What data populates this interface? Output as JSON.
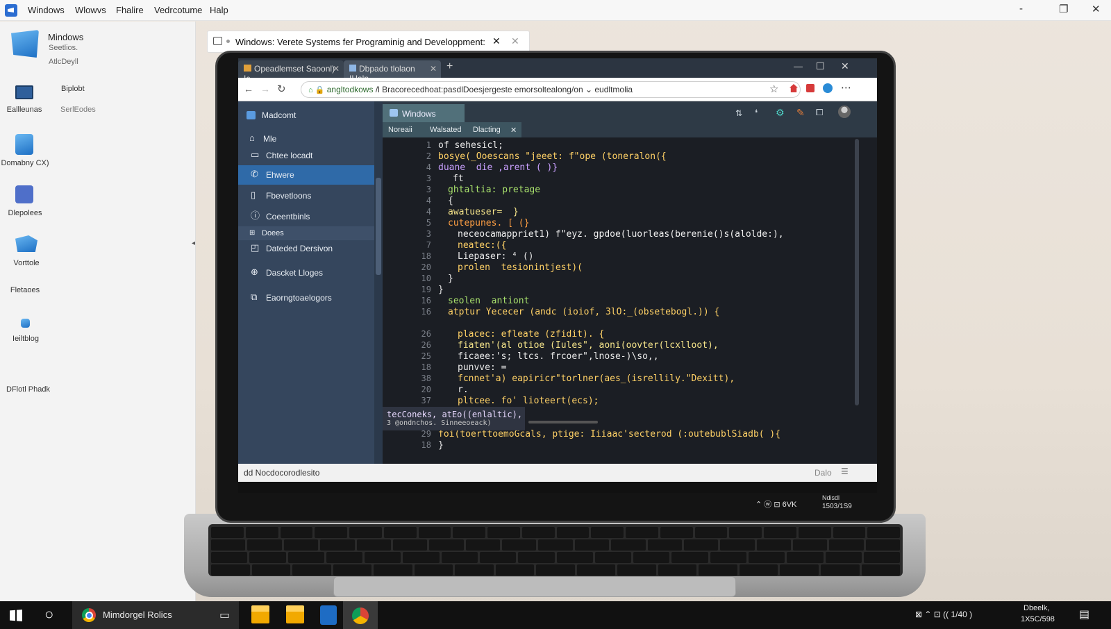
{
  "outer_window": {
    "menu": [
      "Windows",
      "Wlowvs",
      "Fhalire",
      "Vedrcotume",
      "Halp"
    ],
    "controls": {
      "minimize": "-",
      "restore": "❐",
      "close": "✕"
    }
  },
  "left_sidebar": {
    "title": "Mindows",
    "subtitle1": "Seetlios.",
    "subtitle2": "AtlcDeyll",
    "items": [
      {
        "label": "Eallleunas",
        "side": "Biplobt"
      },
      {
        "label": "Domabny CX)",
        "side": "SerlEodes"
      },
      {
        "label": "Dlepolees"
      },
      {
        "label": "Vorttole"
      },
      {
        "label": "Fletaoes"
      },
      {
        "label": "Ieiltblog"
      },
      {
        "label": "DFlotl Phadk"
      }
    ]
  },
  "outer_tab": {
    "title": "Windows: Verete Systems fer Programinig and Developpment:",
    "close": "✕"
  },
  "browser": {
    "tabs": [
      {
        "label": "Opeadlemset Saoonl) Ic"
      },
      {
        "label": "Dbpado tlolaon IHalp"
      }
    ],
    "new_tab": "+",
    "win_controls": {
      "minimize": "—",
      "restore": "☐",
      "close": "✕"
    },
    "url_host": "angltodkows",
    "url_path": "/l Bracorecedhoat:pasdlDoesjergeste emorsoltealong/on ⌄  eudltmolia"
  },
  "sidenav": {
    "header": "Madcomt",
    "items": [
      {
        "label": "Mle",
        "icon": "home-icon",
        "active": false
      },
      {
        "label": "Chtee locadt",
        "icon": "folder-icon",
        "active": false
      },
      {
        "label": "Ehwere",
        "icon": "phone-icon",
        "active": true
      },
      {
        "label": "Fbevetloons",
        "icon": "document-icon",
        "active": false
      },
      {
        "label": "Coeentbinls",
        "icon": "info-icon",
        "active": false
      }
    ],
    "section": "Doees",
    "section_items": [
      {
        "label": "Dateded Dersivon",
        "icon": "window-icon"
      },
      {
        "label": "Dascket Lloges",
        "icon": "globe-icon"
      },
      {
        "label": "Eaorngtoaelogors",
        "icon": "link-icon"
      }
    ]
  },
  "editor": {
    "header_tab": "Windows",
    "sub_tabs": [
      "Noreaii",
      "Walsated",
      "Dlacting"
    ],
    "lines": [
      {
        "n": "1",
        "i": 0,
        "t": "of sehesicl;",
        "c": "#e8e8e8"
      },
      {
        "n": "2",
        "i": 0,
        "t": "bosye(_Ooescans \"jeeet: f\"ope (toneralon({",
        "c": "#ffd166"
      },
      {
        "n": "4",
        "i": 0,
        "t": "duane  die ,arent ( )}",
        "c": "#c9a0ff"
      },
      {
        "n": "3",
        "i": 3,
        "t": "ft",
        "c": "#e8e8e8"
      },
      {
        "n": "3",
        "i": 2,
        "t": "ghtaltia: pretage",
        "c": "#a8e06c"
      },
      {
        "n": "4",
        "i": 2,
        "t": "{",
        "c": "#e8e8e8"
      },
      {
        "n": "4",
        "i": 2,
        "t": "awatueser=  }",
        "c": "#f5e48a"
      },
      {
        "n": "5",
        "i": 2,
        "t": "cutepunes. [ (}",
        "c": "#ff9f43"
      },
      {
        "n": "3",
        "i": 4,
        "t": "neceocamappriet1) f\"eyz. gpdoe(luorleas(berenie()s(alolde:),",
        "c": "#f0f0f0"
      },
      {
        "n": "7",
        "i": 4,
        "t": "neatec:({",
        "c": "#ffd166"
      },
      {
        "n": "18",
        "i": 4,
        "t": "Liepaser: ⁴ ()",
        "c": "#e8e8e8"
      },
      {
        "n": "20",
        "i": 4,
        "t": "prolen  tesionintjest)(",
        "c": "#ffd166"
      },
      {
        "n": "10",
        "i": 2,
        "t": "}",
        "c": "#e8e8e8"
      },
      {
        "n": "19",
        "i": 0,
        "t": "}",
        "c": "#e8e8e8"
      },
      {
        "n": "16",
        "i": 2,
        "t": "seolen  antiont",
        "c": "#a8e06c"
      },
      {
        "n": "16",
        "i": 2,
        "t": "atptur Yececer (andc (ioiof, 3lO:_(obsetebogl.)) {",
        "c": "#ffd166"
      },
      {
        "n": "",
        "i": 0,
        "t": "",
        "c": "#e8e8e8"
      },
      {
        "n": "26",
        "i": 4,
        "t": "placec: efleate (zfidit). {",
        "c": "#ffd166"
      },
      {
        "n": "26",
        "i": 4,
        "t": "fiaten'(al otioe (Iules\", aoni(oovter(lcxlloot),",
        "c": "#f5e48a"
      },
      {
        "n": "25",
        "i": 4,
        "t": "ficaee:'s; ltcs. frcoer\",lnose-)\\so,,",
        "c": "#e8e8e8"
      },
      {
        "n": "18",
        "i": 4,
        "t": "punvve: =",
        "c": "#e8e8e8"
      },
      {
        "n": "38",
        "i": 4,
        "t": "fcnnet'a) eapiricr\"torlner(aes_(isrellily.\"Dexitt),",
        "c": "#ffd166"
      },
      {
        "n": "20",
        "i": 4,
        "t": "r.",
        "c": "#e8e8e8"
      },
      {
        "n": "37",
        "i": 4,
        "t": "pltcee. fo' lioteert(ecs);",
        "c": "#ffd166"
      },
      {
        "n": "24",
        "i": 2,
        "t": "}",
        "c": "#e8e8e8"
      },
      {
        "n": "19",
        "i": 0,
        "t": "}",
        "c": "#e8e8e8"
      },
      {
        "n": "29",
        "i": 0,
        "t": "foi(toerttoemoGcals, ptige: Iiiaac'secterod (:outebublSiadb( ){",
        "c": "#ffd166"
      },
      {
        "n": "18",
        "i": 0,
        "t": "}",
        "c": "#e8e8e8"
      }
    ],
    "popup_line1": "tecConeks, atEo((enlaltic),",
    "popup_line2": "3  @ondnchos. Sinneeoeack)"
  },
  "statusbar": {
    "left": "dd  Nocdocorodlesito",
    "right": "Dalo"
  },
  "tray": {
    "text": "⌃  ⓦ  ⊡  6VK",
    "clock_line1": "Ndisdl",
    "clock_line2": "1503/1S9"
  },
  "taskbar": {
    "search": "○",
    "browser_label": "Mimdorgel Rolics",
    "clock_line1": "Dbeelk,",
    "clock_line2": "1X5C/598",
    "tray": "⊠  ⌃  ⊡  ((  1/40 )"
  }
}
